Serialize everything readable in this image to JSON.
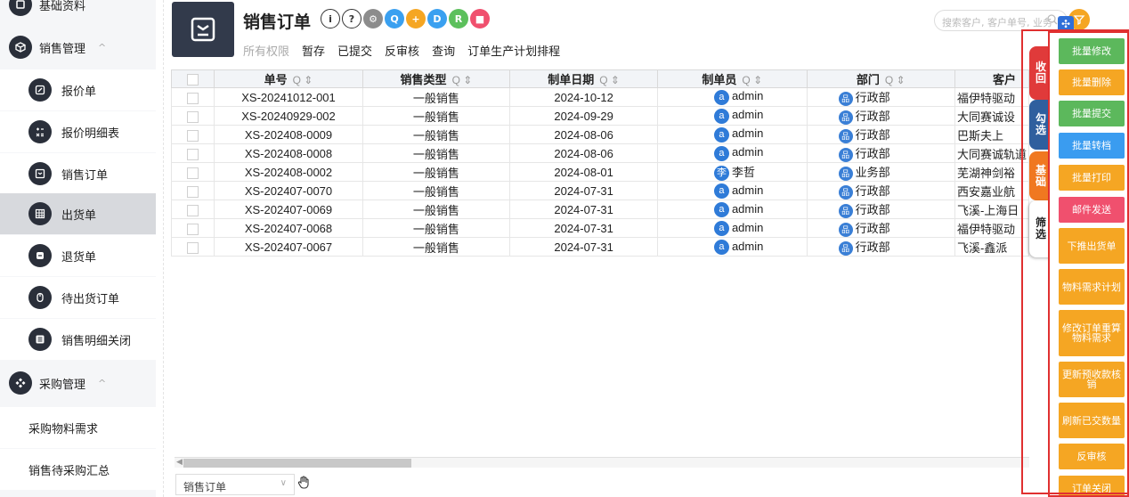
{
  "sidebar": {
    "top_partial": {
      "label": "基础资料",
      "icon": "database-icon"
    },
    "sales_section": {
      "label": "销售管理",
      "caret": "^",
      "icon": "cube-icon"
    },
    "items": [
      {
        "label": "报价单",
        "icon": "edit-icon"
      },
      {
        "label": "报价明细表",
        "icon": "calculator-icon"
      },
      {
        "label": "销售订单",
        "icon": "monitor-icon"
      },
      {
        "label": "出货单",
        "icon": "grid-icon"
      },
      {
        "label": "退货单",
        "icon": "return-icon"
      },
      {
        "label": "待出货订单",
        "icon": "mouse-icon"
      },
      {
        "label": "销售明细关闭",
        "icon": "list-icon"
      }
    ],
    "purchase_section": {
      "label": "采购管理",
      "caret": "^",
      "icon": "diamond-grid-icon"
    },
    "plain_items": [
      {
        "label": "采购物料需求"
      },
      {
        "label": "销售待采购汇总"
      }
    ]
  },
  "header": {
    "title": "销售订单",
    "icons": [
      {
        "name": "info-icon",
        "glyph": "i",
        "color": "#ffffff"
      },
      {
        "name": "help-icon",
        "glyph": "?",
        "color": "#ffffff"
      },
      {
        "name": "settings-icon",
        "glyph": "⚙",
        "color": "#8c8c8c"
      },
      {
        "name": "search-icon",
        "glyph": "Q",
        "color": "#3aa0f0"
      },
      {
        "name": "add-icon",
        "glyph": "+",
        "color": "#f5a623"
      },
      {
        "name": "document-icon",
        "glyph": "D",
        "color": "#3aa0f0"
      },
      {
        "name": "recycle-icon",
        "glyph": "R",
        "color": "#5cc05c"
      },
      {
        "name": "stop-icon",
        "glyph": "■",
        "color": "#f0506e"
      }
    ],
    "tabs": [
      {
        "label": "所有权限",
        "muted": true
      },
      {
        "label": "暂存"
      },
      {
        "label": "已提交"
      },
      {
        "label": "反审核"
      },
      {
        "label": "查询"
      },
      {
        "label": "订单生产计划排程"
      }
    ],
    "search_placeholder": "搜索客户, 客户单号, 业务"
  },
  "table": {
    "columns": [
      "单号",
      "销售类型",
      "制单日期",
      "制单员",
      "部门",
      "客户"
    ],
    "rows": [
      {
        "no": "XS-20241012-001",
        "type": "一般销售",
        "date": "2024-10-12",
        "avatar": "a",
        "user": "admin",
        "dept": "行政部",
        "customer": "福伊特驱动"
      },
      {
        "no": "XS-20240929-002",
        "type": "一般销售",
        "date": "2024-09-29",
        "avatar": "a",
        "user": "admin",
        "dept": "行政部",
        "customer": "大同赛诚设"
      },
      {
        "no": "XS-202408-0009",
        "type": "一般销售",
        "date": "2024-08-06",
        "avatar": "a",
        "user": "admin",
        "dept": "行政部",
        "customer": "巴斯夫上"
      },
      {
        "no": "XS-202408-0008",
        "type": "一般销售",
        "date": "2024-08-06",
        "avatar": "a",
        "user": "admin",
        "dept": "行政部",
        "customer": "大同赛诚轨道"
      },
      {
        "no": "XS-202408-0002",
        "type": "一般销售",
        "date": "2024-08-01",
        "avatar": "李",
        "user": "李哲",
        "dept": "业务部",
        "customer": "芜湖神剑裕"
      },
      {
        "no": "XS-202407-0070",
        "type": "一般销售",
        "date": "2024-07-31",
        "avatar": "a",
        "user": "admin",
        "dept": "行政部",
        "customer": "西安嘉业航"
      },
      {
        "no": "XS-202407-0069",
        "type": "一般销售",
        "date": "2024-07-31",
        "avatar": "a",
        "user": "admin",
        "dept": "行政部",
        "customer": "飞溪-上海日"
      },
      {
        "no": "XS-202407-0068",
        "type": "一般销售",
        "date": "2024-07-31",
        "avatar": "a",
        "user": "admin",
        "dept": "行政部",
        "customer": "福伊特驱动"
      },
      {
        "no": "XS-202407-0067",
        "type": "一般销售",
        "date": "2024-07-31",
        "avatar": "a",
        "user": "admin",
        "dept": "行政部",
        "customer": "飞溪-鑫派"
      }
    ]
  },
  "footer": {
    "select_value": "销售订单"
  },
  "side_tabs": [
    {
      "label": "收回",
      "color": "#e03a3a"
    },
    {
      "label": "勾选",
      "color": "#2f5f9e"
    },
    {
      "label": "基础",
      "color": "#f07820"
    },
    {
      "label": "筛选",
      "color": "#ffffff",
      "text_color": "#222222"
    }
  ],
  "actions": [
    {
      "label": "批量修改",
      "color": "#5cb85c"
    },
    {
      "label": "批量删除",
      "color": "#f5a623"
    },
    {
      "label": "批量提交",
      "color": "#5cb85c"
    },
    {
      "label": "批量转档",
      "color": "#3a9cf0"
    },
    {
      "label": "批量打印",
      "color": "#f5a623"
    },
    {
      "label": "邮件发送",
      "color": "#f0506e"
    },
    {
      "label": "下推出货单",
      "color": "#f5a623"
    },
    {
      "label": "物料需求计划",
      "color": "#f5a623"
    },
    {
      "label": "修改订单重算物料需求",
      "color": "#f5a623"
    },
    {
      "label": "更新预收款核销",
      "color": "#f5a623"
    },
    {
      "label": "刷新已交数量",
      "color": "#f5a623"
    },
    {
      "label": "反审核",
      "color": "#f5a623"
    },
    {
      "label": "订单关闭",
      "color": "#f5a623"
    }
  ]
}
